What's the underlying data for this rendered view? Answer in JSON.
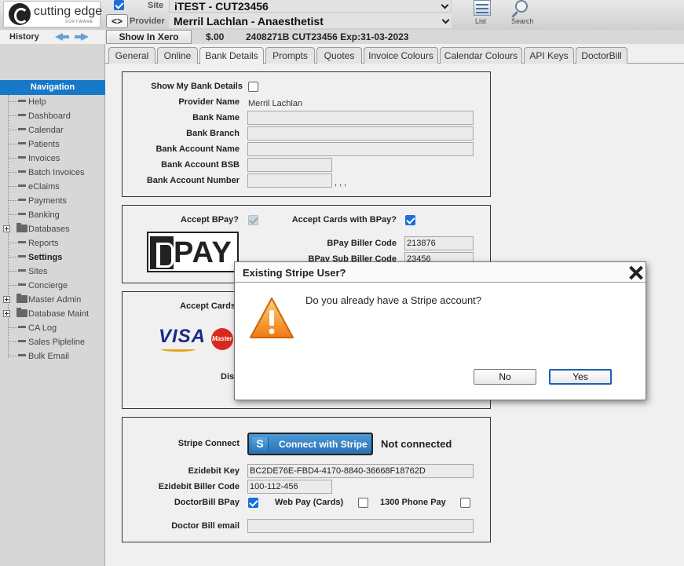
{
  "app": {
    "logo_text": "cutting edge",
    "logo_subtext": "SOFTWARE"
  },
  "top": {
    "site_label": "Site",
    "site_value": "iTEST - CUT23456",
    "provider_label": "Provider",
    "provider_value": "Merril Lachlan - Anaesthetist",
    "toggle_label": "<>",
    "list_label": "List",
    "search_label": "Search"
  },
  "infobar": {
    "history_label": "History",
    "xero_label": "Show In Xero",
    "balance": "$.00",
    "patient_info": "2408271B CUT23456 Exp:31-03-2023"
  },
  "nav": {
    "header": "Navigation",
    "items": [
      {
        "label": "Help",
        "type": "item"
      },
      {
        "label": "Dashboard",
        "type": "item"
      },
      {
        "label": "Calendar",
        "type": "item"
      },
      {
        "label": "Patients",
        "type": "item"
      },
      {
        "label": "Invoices",
        "type": "item"
      },
      {
        "label": "Batch Invoices",
        "type": "item"
      },
      {
        "label": "eClaims",
        "type": "item"
      },
      {
        "label": "Payments",
        "type": "item"
      },
      {
        "label": "Banking",
        "type": "item"
      },
      {
        "label": "Databases",
        "type": "folder"
      },
      {
        "label": "Reports",
        "type": "item"
      },
      {
        "label": "Settings",
        "type": "item",
        "active": true
      },
      {
        "label": "Sites",
        "type": "item"
      },
      {
        "label": "Concierge",
        "type": "item"
      },
      {
        "label": "Master Admin",
        "type": "folder"
      },
      {
        "label": "Database Maint",
        "type": "folder"
      },
      {
        "label": "CA Log",
        "type": "item"
      },
      {
        "label": "Sales Pipleline",
        "type": "item"
      },
      {
        "label": "Bulk Email",
        "type": "item"
      }
    ]
  },
  "tabs": [
    "General",
    "Online",
    "Bank Details",
    "Prompts",
    "Quotes",
    "Invoice Colours",
    "Calendar Colours",
    "API Keys",
    "DoctorBill"
  ],
  "active_tab": "Bank Details",
  "bank": {
    "show_label": "Show My Bank Details",
    "provider_name_label": "Provider Name",
    "provider_name_value": "Merril Lachlan",
    "bank_name_label": "Bank Name",
    "bank_branch_label": "Bank Branch",
    "account_name_label": "Bank Account Name",
    "bsb_label": "Bank Account BSB",
    "account_number_label": "Bank Account Number",
    "account_number_suffix": ", , ,"
  },
  "bpay": {
    "accept_label": "Accept BPay?",
    "accept_cards_label": "Accept Cards with BPay?",
    "logo_text": "PAY",
    "biller_code_label": "BPay Biller Code",
    "biller_code_value": "213876",
    "sub_biller_label": "BPay Sub Biller Code",
    "sub_biller_value": "23456"
  },
  "cards": {
    "accept_label": "Accept Cards",
    "visa_text": "VISA",
    "mastercard_text": "Master",
    "dis_label": "Dis"
  },
  "stripe": {
    "connect_label": "Stripe Connect",
    "button_icon": "S",
    "button_label": "Connect with Stripe",
    "status": "Not connected",
    "ezidebit_key_label": "Ezidebit Key",
    "ezidebit_key_value": "BC2DE76E-FBD4-4170-8840-36668F18762D",
    "ezidebit_biller_label": "Ezidebit Biller Code",
    "ezidebit_biller_value": "100-112-456",
    "doctorbill_bpay_label": "DoctorBill BPay",
    "webpay_label": "Web Pay (Cards)",
    "phonepay_label": "1300 Phone Pay",
    "email_label": "Doctor Bill email"
  },
  "dialog": {
    "title": "Existing Stripe User?",
    "message": "Do you already have a Stripe account?",
    "no_label": "No",
    "yes_label": "Yes"
  },
  "colors": {
    "nav_header": "#1878c8",
    "checkbox_on": "#1a6fd8",
    "stripe_button": "#2a70b3"
  }
}
